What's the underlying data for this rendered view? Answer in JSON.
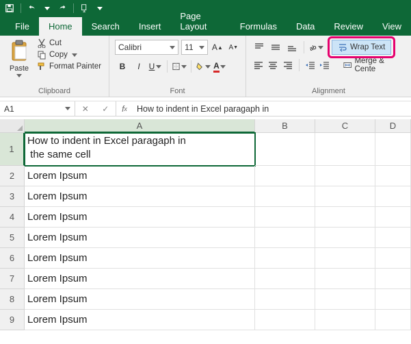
{
  "titlebar": {
    "save_icon": "save-icon",
    "undo_icon": "undo-icon",
    "redo_icon": "redo-icon",
    "touch_icon": "touch-mode-icon"
  },
  "tabs": [
    "File",
    "Home",
    "Search",
    "Insert",
    "Page Layout",
    "Formulas",
    "Data",
    "Review",
    "View"
  ],
  "active_tab": "Home",
  "ribbon": {
    "clipboard": {
      "paste": "Paste",
      "cut": "Cut",
      "copy": "Copy",
      "format_painter": "Format Painter",
      "group_label": "Clipboard"
    },
    "font": {
      "name": "Calibri",
      "size": "11",
      "group_label": "Font"
    },
    "alignment": {
      "wrap_text": "Wrap Text",
      "merge": "Merge & Cente",
      "group_label": "Alignment"
    }
  },
  "formula_bar": {
    "name_box": "A1",
    "formula": "How to indent in Excel paragaph in"
  },
  "columns": [
    "A",
    "B",
    "C",
    "D"
  ],
  "rows": [
    {
      "num": "1",
      "a": "How to indent in Excel paragaph in\n the same cell",
      "tall": true,
      "selected": true
    },
    {
      "num": "2",
      "a": "Lorem Ipsum"
    },
    {
      "num": "3",
      "a": "Lorem Ipsum"
    },
    {
      "num": "4",
      "a": "Lorem Ipsum"
    },
    {
      "num": "5",
      "a": "Lorem Ipsum"
    },
    {
      "num": "6",
      "a": "Lorem Ipsum"
    },
    {
      "num": "7",
      "a": "Lorem Ipsum"
    },
    {
      "num": "8",
      "a": "Lorem Ipsum"
    },
    {
      "num": "9",
      "a": "Lorem Ipsum"
    }
  ]
}
